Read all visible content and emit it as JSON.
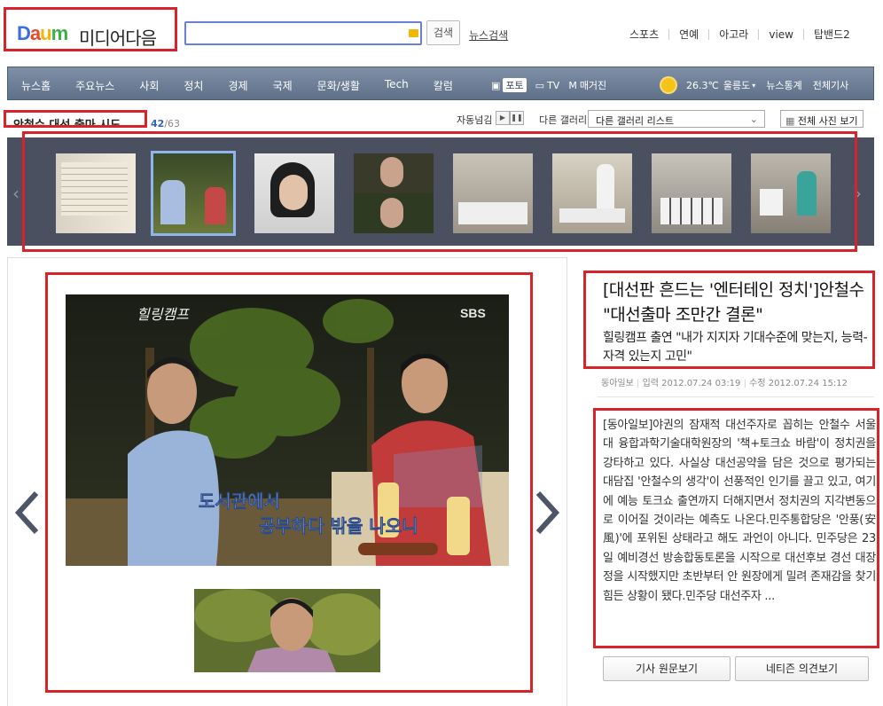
{
  "header": {
    "logo_daum": "Daum",
    "logo_section": "미디어다음",
    "search_value": "",
    "search_button": "검색",
    "news_search": "뉴스검색",
    "top_links": [
      "스포츠",
      "연예",
      "아고라",
      "view",
      "탑밴드2"
    ]
  },
  "nav": {
    "items": [
      "뉴스홈",
      "주요뉴스",
      "사회",
      "정치",
      "경제",
      "국제",
      "문화/생활",
      "Tech",
      "칼럼"
    ],
    "media": [
      "포토",
      "TV",
      "매거진"
    ],
    "weather_temp": "26.3℃",
    "weather_region": "울릉도",
    "links": [
      "뉴스통계",
      "전체기사"
    ]
  },
  "gallery": {
    "title": "안철수 대선 출마 시도",
    "counter_current": "42",
    "counter_total": "/63",
    "autoplay_label": "자동넘김",
    "other_gallery_label": "다른 갤러리",
    "other_gallery_select": "다른 갤러리 리스트",
    "all_photos_button": "전체 사진 보기"
  },
  "article": {
    "headline": "[대선판 흔드는 '엔터테인 정치']안철수 \"대선출마 조만간 결론\"",
    "subheadline": "힐링캠프 출연 \"내가 지지자 기대수준에 맞는지, 능력-자격 있는지 고민\"",
    "source": "동아일보",
    "input_label": "입력",
    "input_time": "2012.07.24 03:19",
    "edit_label": "수정",
    "edit_time": "2012.07.24 15:12",
    "body": "[동아일보]야권의 잠재적 대선주자로 꼽히는 안철수 서울대 융합과학기술대학원장의 '책+토크쇼 바람'이 정치권을 강타하고 있다. 사실상 대선공약을 담은 것으로 평가되는 대담집 '안철수의 생각'이 선풍적인 인기를 끌고 있고, 여기에 예능 토크쇼 출연까지 더해지면서 정치권의 지각변동으로 이어질 것이라는 예측도 나온다.민주통합당은 '안풍(安風)'에 포위된 상태라고 해도 과언이 아니다. 민주당은 23일 예비경선 방송합동토론을 시작으로 대선후보 경선 대장정을 시작했지만 초반부터 안 원장에게 밀려 존재감을 찾기 힘든 상황이 됐다.민주당 대선주자 ...",
    "btn_original": "기사 원문보기",
    "btn_comments": "네티즌 의견보기"
  },
  "image_text": {
    "program_logo": "힐링캠프",
    "broadcaster": "SBS",
    "caption_line1": "도서관에서",
    "caption_line2": "공부하다 밖을 나오니"
  },
  "colors": {
    "highlight": "#d8232a",
    "nav_bg": "#6b7c94",
    "strip_bg": "#4a5060",
    "link_blue": "#2f64c6"
  }
}
